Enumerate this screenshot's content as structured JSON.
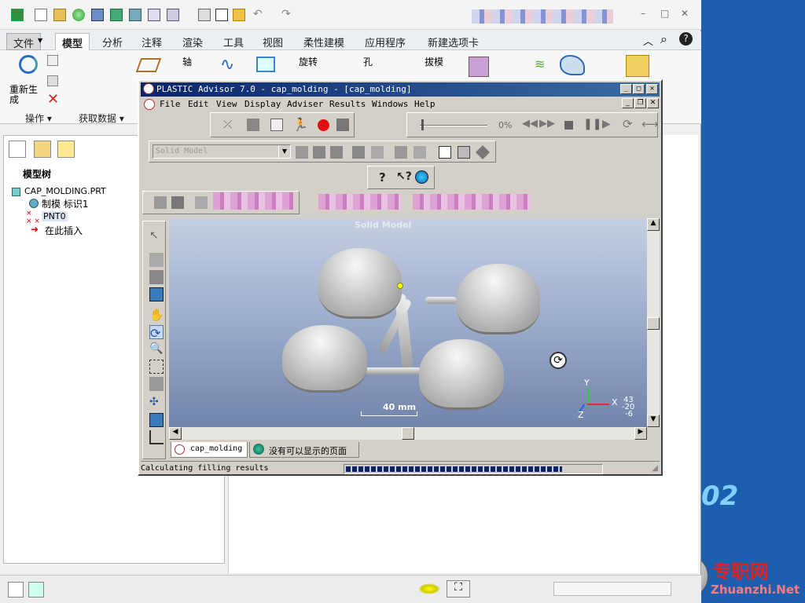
{
  "creo": {
    "quick_access_icons": [
      "new-icon",
      "open-icon",
      "regen-icon",
      "save-icon",
      "windows-icon",
      "close-win-icon",
      "display-icon",
      "undo-icon",
      "redo-icon"
    ],
    "tabs": [
      "文件",
      "模型",
      "分析",
      "注释",
      "渲染",
      "工具",
      "视图",
      "柔性建模",
      "应用程序",
      "新建选项卡"
    ],
    "active_tab": "模型",
    "ribbon": {
      "regenerate": "重新生成",
      "axis": "轴",
      "rotate": "旋转",
      "hole": "孔",
      "draft": "拔模",
      "group_operations": "操作",
      "group_get_data": "获取数据"
    },
    "model_tree": {
      "title": "模型树",
      "items": [
        "CAP_MOLDING.PRT",
        "制模 标识1",
        "PNT0",
        "在此插入"
      ]
    }
  },
  "plastic_advisor": {
    "title": "PLASTIC Advisor 7.0 - cap_molding - [cap_molding]",
    "menu": [
      "File",
      "Edit",
      "View",
      "Display",
      "Adviser",
      "Results",
      "Windows",
      "Help"
    ],
    "zoom_percent": "0%",
    "model_select": "Solid Model",
    "viewport_label": "Solid Model",
    "scale_label": "40 mm",
    "axis": {
      "x": "X",
      "y": "Y",
      "z": "Z",
      "coords": [
        "43",
        "-20",
        "-6"
      ]
    },
    "doc_tabs": [
      "cap_molding",
      "没有可以显示的页面"
    ],
    "status_text": "Calculating filling results",
    "progress": 0.85
  },
  "watermark": {
    "year_fragment": "02",
    "site_cn": "专职网",
    "site_en": "Zhuanzhi.Net"
  },
  "colors": {
    "desktop": "#1d5fae",
    "title_bar": "#0a246a",
    "progress": "#0a246a"
  }
}
